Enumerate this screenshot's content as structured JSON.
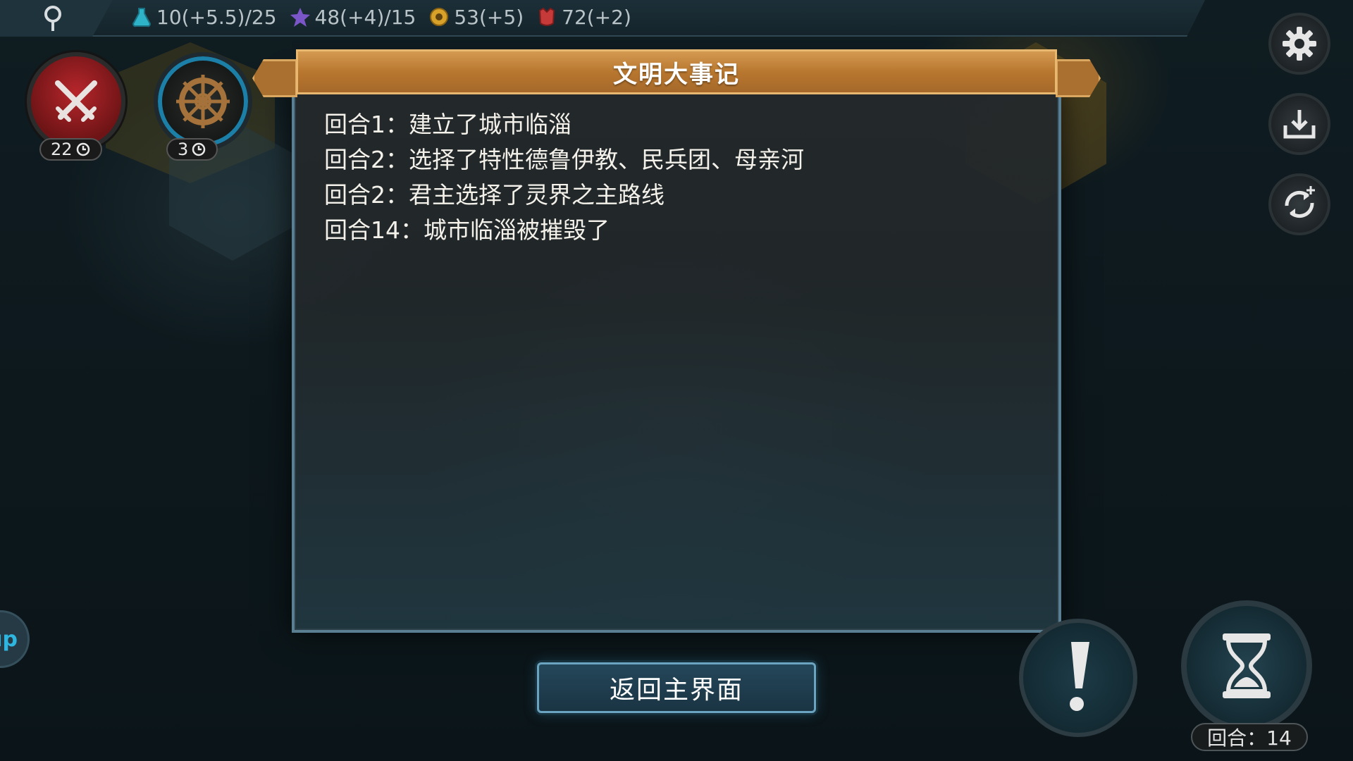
{
  "top_bar": {
    "resources": [
      {
        "icon": "flask-icon",
        "value": "10(+5.5)/25",
        "color": "#2fb3c9"
      },
      {
        "icon": "star-icon",
        "value": "48(+4)/15",
        "color": "#7b56c9"
      },
      {
        "icon": "coin-icon",
        "value": "53(+5)",
        "color": "#d8a22a"
      },
      {
        "icon": "faith-icon",
        "value": "72(+2)",
        "color": "#c63a3a"
      }
    ]
  },
  "left_panel": {
    "war_counter": "22",
    "wheel_counter": "3"
  },
  "dialog": {
    "title": "文明大事记",
    "events": [
      "回合1：建立了城市临淄",
      "回合2：选择了特性德鲁伊教、民兵团、母亲河",
      "回合2：君主选择了灵界之主路线",
      "回合14：城市临淄被摧毁了"
    ],
    "back_label": "返回主界面"
  },
  "bottom_right": {
    "turn_label": "回合：14"
  },
  "edge_button_text": "up"
}
